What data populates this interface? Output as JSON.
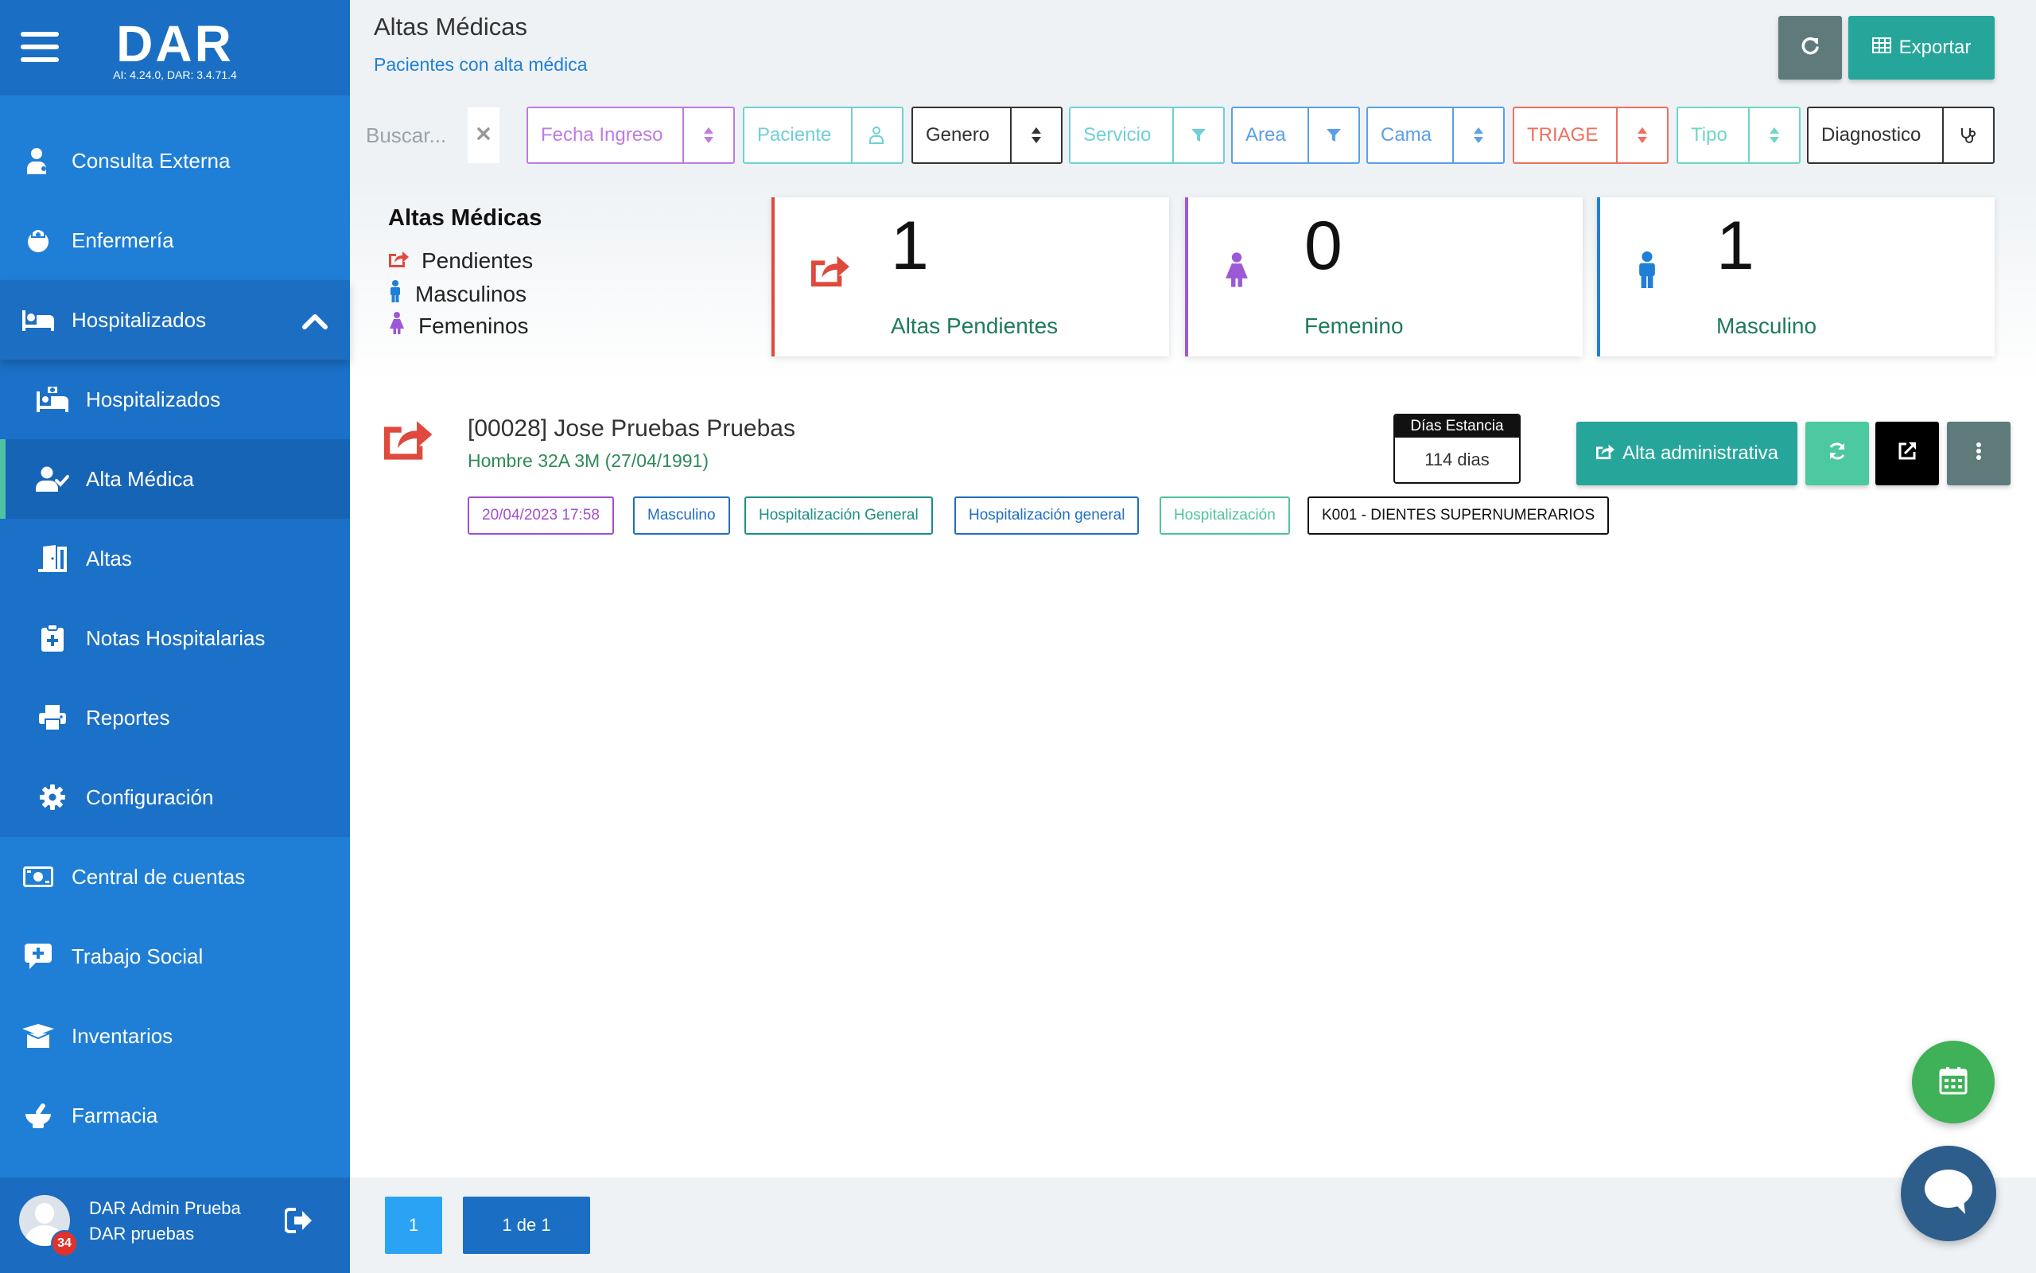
{
  "brand": {
    "name": "DAR",
    "version": "AI: 4.24.0, DAR: 3.4.71.4"
  },
  "sidebar": {
    "items": [
      {
        "label": "Consulta Externa",
        "icon": "doctor-icon"
      },
      {
        "label": "Enfermería",
        "icon": "nurse-icon"
      },
      {
        "label": "Hospitalizados",
        "icon": "bed-icon",
        "expanded": true
      },
      {
        "label": "Hospitalizados",
        "icon": "hospital-bed-icon"
      },
      {
        "label": "Alta Médica",
        "icon": "user-check-icon",
        "active": true
      },
      {
        "label": "Altas",
        "icon": "door-exit-icon"
      },
      {
        "label": "Notas Hospitalarias",
        "icon": "clipboard-plus-icon"
      },
      {
        "label": "Reportes",
        "icon": "printer-icon"
      },
      {
        "label": "Configuración",
        "icon": "gear-icon"
      },
      {
        "label": "Central de cuentas",
        "icon": "money-icon"
      },
      {
        "label": "Trabajo Social",
        "icon": "comment-medical-icon"
      },
      {
        "label": "Inventarios",
        "icon": "box-open-icon"
      },
      {
        "label": "Farmacia",
        "icon": "mortar-pestle-icon"
      }
    ]
  },
  "user": {
    "name": "DAR Admin Prueba",
    "org": "DAR pruebas",
    "notifications": "34"
  },
  "header": {
    "title": "Altas Médicas",
    "subtitle": "Pacientes con alta médica",
    "export_label": "Exportar"
  },
  "filters": {
    "search_placeholder": "Buscar...",
    "items": [
      {
        "label": "Fecha Ingreso",
        "color": "#c07be0"
      },
      {
        "label": "Paciente",
        "color": "#6fd0d6"
      },
      {
        "label": "Genero",
        "color": "#333333"
      },
      {
        "label": "Servicio",
        "color": "#6fd0d6"
      },
      {
        "label": "Area",
        "color": "#5b9fe8"
      },
      {
        "label": "Cama",
        "color": "#5b9fe8"
      },
      {
        "label": "TRIAGE",
        "color": "#ef6f5f"
      },
      {
        "label": "Tipo",
        "color": "#6fd6c6"
      },
      {
        "label": "Diagnostico",
        "color": "#333333"
      }
    ]
  },
  "summary": {
    "title": "Altas Médicas",
    "legend": [
      "Pendientes",
      "Masculinos",
      "Femeninos"
    ],
    "cards": [
      {
        "value": "1",
        "label": "Altas Pendientes",
        "color": "#e0493d"
      },
      {
        "value": "0",
        "label": "Femenino",
        "color": "#9b59d8"
      },
      {
        "value": "1",
        "label": "Masculino",
        "color": "#1f7fd6"
      }
    ]
  },
  "patient": {
    "name": "[00028] Jose Pruebas Pruebas",
    "info": "Hombre 32A 3M (27/04/1991)",
    "stay_header": "Días Estancia",
    "stay_value": "114 dias",
    "tags": [
      {
        "text": "20/04/2023 17:58",
        "color": "#a24fd0"
      },
      {
        "text": "Masculino",
        "color": "#1f6fc2"
      },
      {
        "text": "Hospitalización General",
        "color": "#1b8f86"
      },
      {
        "text": "Hospitalización general",
        "color": "#1f6fc2"
      },
      {
        "text": "Hospitalización",
        "color": "#4fc3a1"
      },
      {
        "text": "K001 - DIENTES SUPERNUMERARIOS",
        "color": "#111111"
      }
    ],
    "actions": {
      "discharge_label": "Alta administrativa"
    }
  },
  "pagination": {
    "current": "1",
    "summary": "1 de 1"
  }
}
